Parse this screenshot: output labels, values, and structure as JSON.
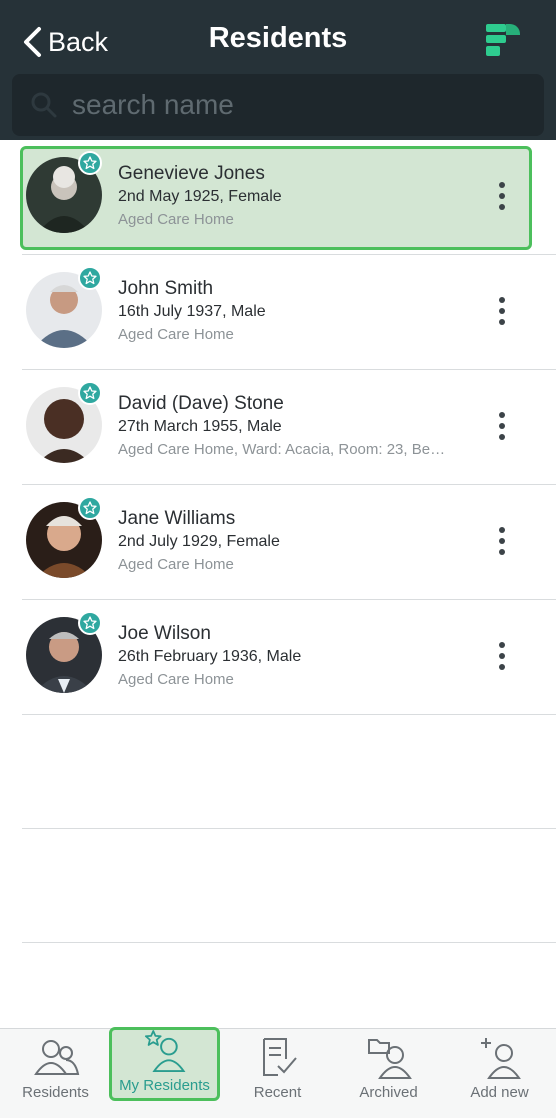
{
  "header": {
    "back_label": "Back",
    "title": "Residents"
  },
  "search": {
    "placeholder": "search name",
    "value": ""
  },
  "residents": [
    {
      "name": "Genevieve Jones",
      "details": "2nd May 1925, Female",
      "location": "Aged Care Home",
      "favorite": true,
      "selected": true
    },
    {
      "name": "John Smith",
      "details": "16th July 1937, Male",
      "location": "Aged Care Home",
      "favorite": true,
      "selected": false
    },
    {
      "name": "David (Dave) Stone",
      "details": "27th March 1955, Male",
      "location": "Aged Care Home, Ward: Acacia, Room: 23, Be…",
      "favorite": true,
      "selected": false
    },
    {
      "name": "Jane Williams",
      "details": "2nd July 1929, Female",
      "location": "Aged Care Home",
      "favorite": true,
      "selected": false
    },
    {
      "name": "Joe Wilson",
      "details": "26th February 1936, Male",
      "location": "Aged Care Home",
      "favorite": true,
      "selected": false
    }
  ],
  "tabs": [
    {
      "label": "Residents",
      "icon": "residents-icon",
      "active": false
    },
    {
      "label": "My Residents",
      "icon": "my-residents-icon",
      "active": true
    },
    {
      "label": "Recent",
      "icon": "recent-icon",
      "active": false
    },
    {
      "label": "Archived",
      "icon": "archived-icon",
      "active": false
    },
    {
      "label": "Add new",
      "icon": "add-new-icon",
      "active": false
    }
  ],
  "colors": {
    "header_bg": "#263238",
    "accent_teal": "#2fa8a0",
    "selection_green": "#4cbf5c",
    "selection_fill": "#d3e6d3"
  }
}
